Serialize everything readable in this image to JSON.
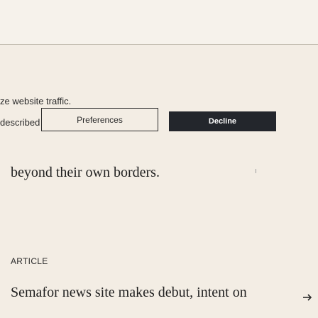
{
  "cookie_banner": {
    "text_line_1": "ze website traffic.",
    "text_line_2": "described in our",
    "preferences_label": "Preferences",
    "decline_label": "Decline"
  },
  "feed": {
    "headline_fragment": "beyond their own borders.",
    "section_label": "ARTICLE",
    "article_title": "Semafor news site makes debut, intent on"
  },
  "icons": {
    "article_arrow": "arrow-right-icon"
  },
  "colors": {
    "background": "#f3ede4",
    "decline_button": "#23262c",
    "text": "#2b2b2b"
  }
}
